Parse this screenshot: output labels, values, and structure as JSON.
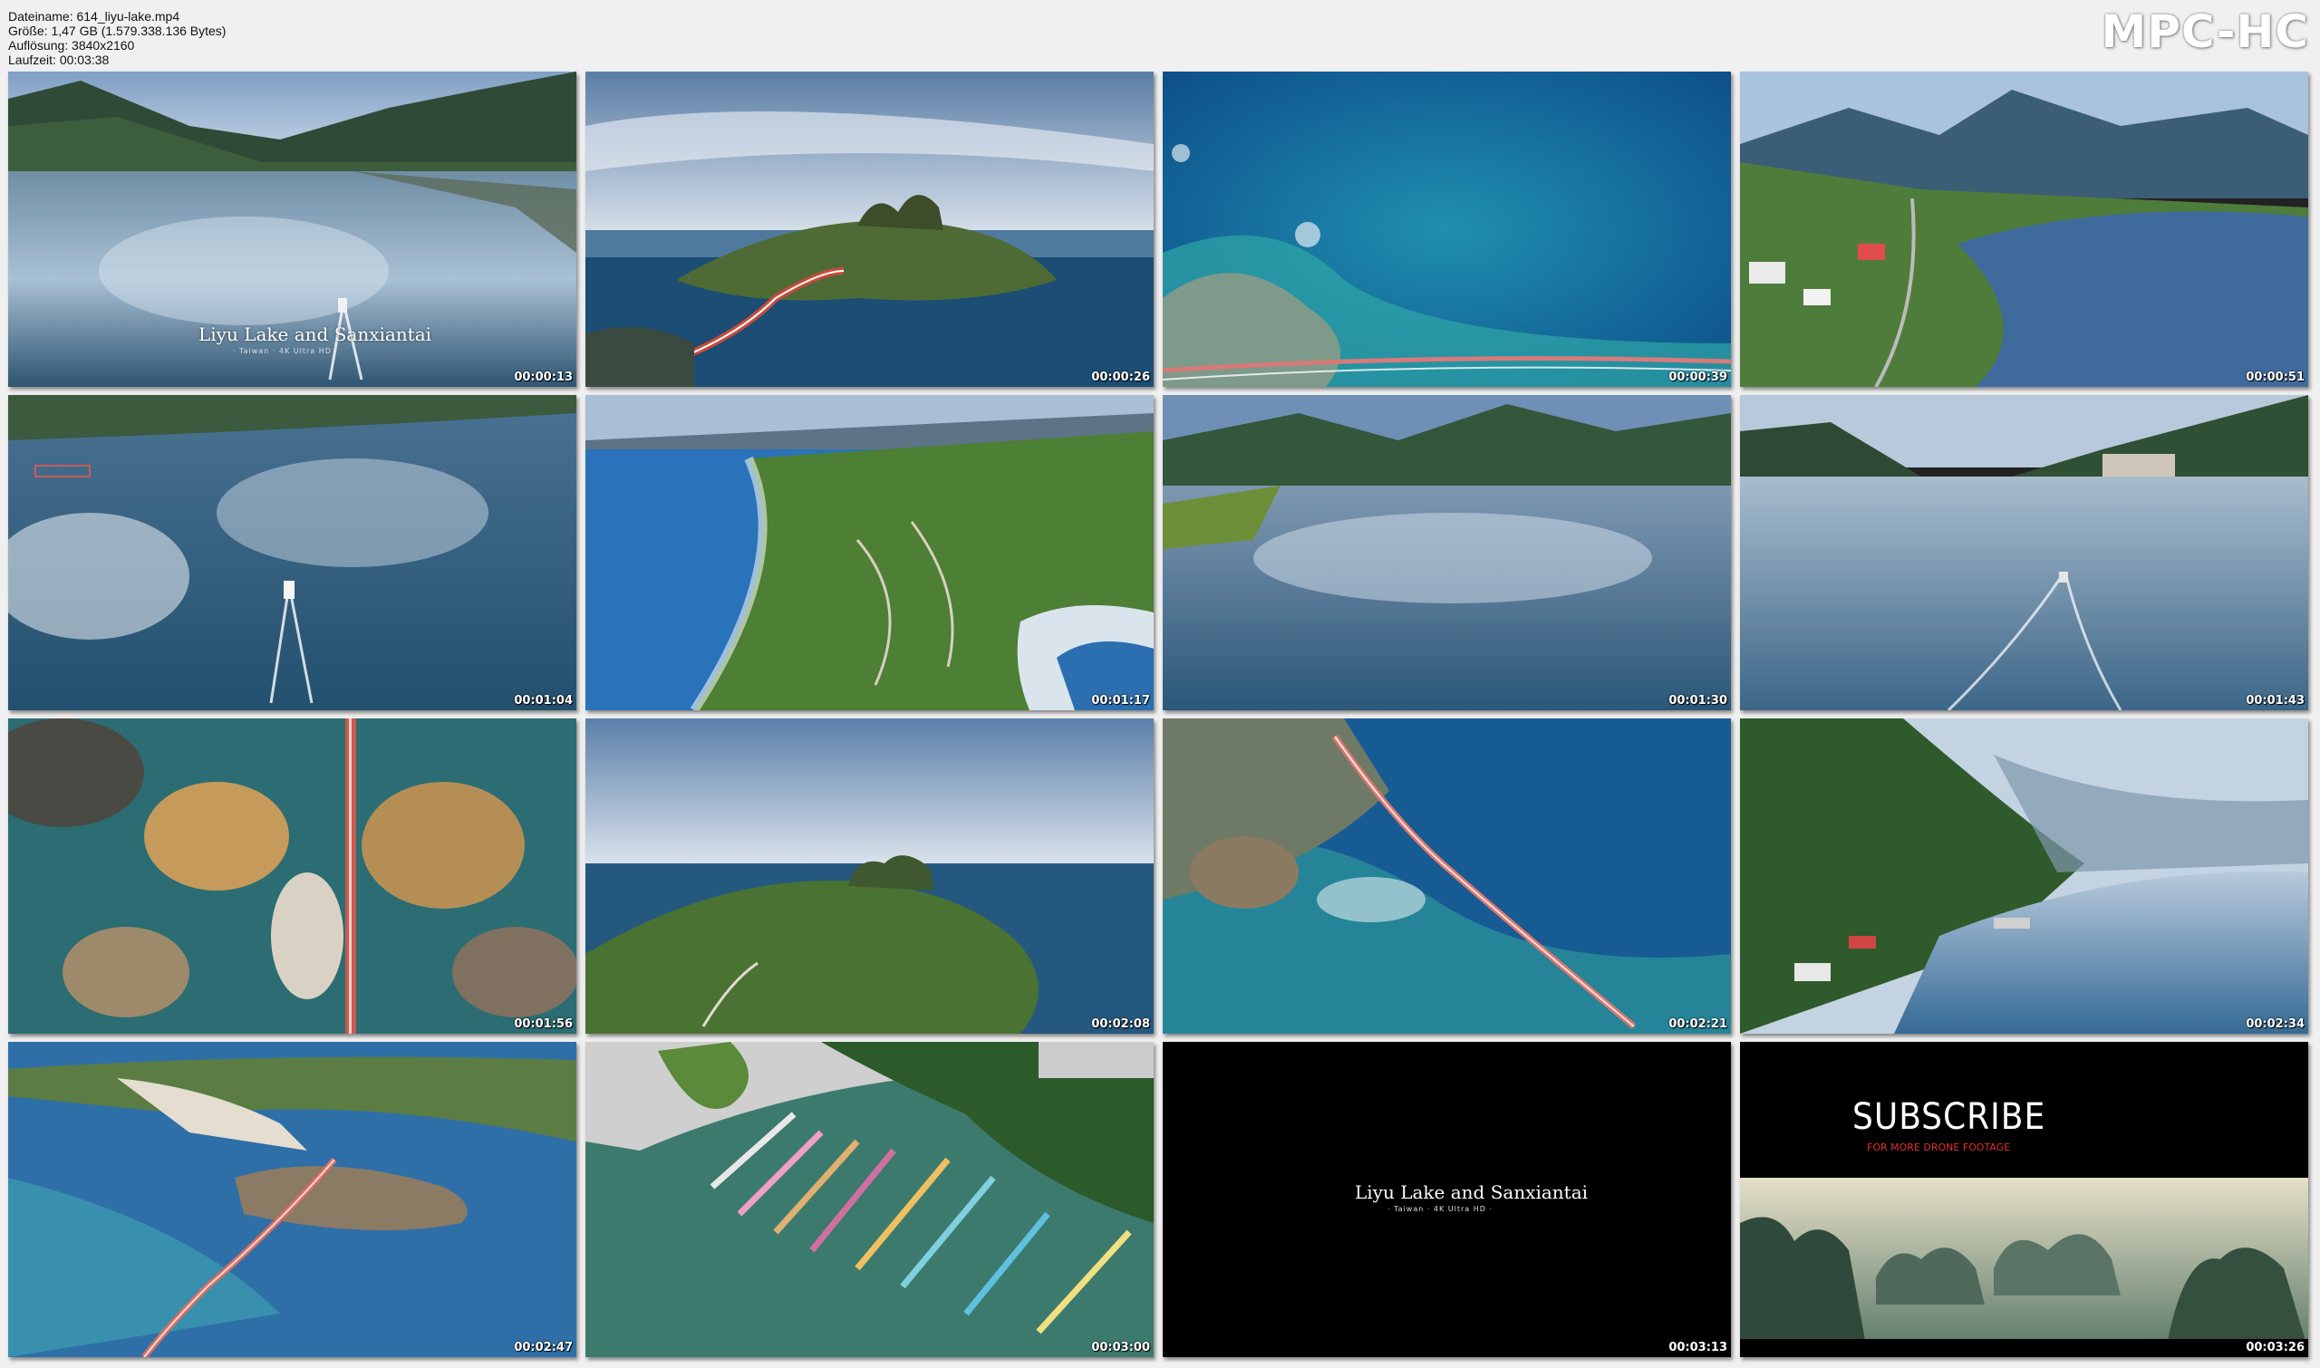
{
  "meta": {
    "filename_line": "Dateiname: 614_liyu-lake.mp4",
    "size_line": "Größe: 1,47 GB (1.579.338.136 Bytes)",
    "resolution_line": "Auflösung: 3840x2160",
    "duration_line": "Laufzeit: 00:03:38"
  },
  "logo": "MPC-HC",
  "thumbnails": [
    {
      "timestamp": "00:00:13",
      "scene": "lake-boat",
      "title": "Liyu Lake and Sanxiantai",
      "subtitle": "· Taiwan · 4K Ultra HD ·"
    },
    {
      "timestamp": "00:00:26",
      "scene": "island-bridge"
    },
    {
      "timestamp": "00:00:39",
      "scene": "coral-coast"
    },
    {
      "timestamp": "00:00:51",
      "scene": "lake-village"
    },
    {
      "timestamp": "00:01:04",
      "scene": "lake-reflection"
    },
    {
      "timestamp": "00:01:17",
      "scene": "green-coast"
    },
    {
      "timestamp": "00:01:30",
      "scene": "calm-lake"
    },
    {
      "timestamp": "00:01:43",
      "scene": "lake-speedboat"
    },
    {
      "timestamp": "00:01:56",
      "scene": "rocks-topdown"
    },
    {
      "timestamp": "00:02:08",
      "scene": "island-sea"
    },
    {
      "timestamp": "00:02:21",
      "scene": "bridge-reef"
    },
    {
      "timestamp": "00:02:34",
      "scene": "misty-lake"
    },
    {
      "timestamp": "00:02:47",
      "scene": "reef-bridge-wide"
    },
    {
      "timestamp": "00:03:00",
      "scene": "pedal-boats"
    },
    {
      "timestamp": "00:03:13",
      "scene": "title-card",
      "title": "Liyu Lake and Sanxiantai",
      "subtitle": "· Taiwan · 4K Ultra HD ·"
    },
    {
      "timestamp": "00:03:26",
      "scene": "subscribe",
      "title": "SUBSCRIBE",
      "subtitle": "FOR MORE DRONE FOOTAGE"
    }
  ]
}
